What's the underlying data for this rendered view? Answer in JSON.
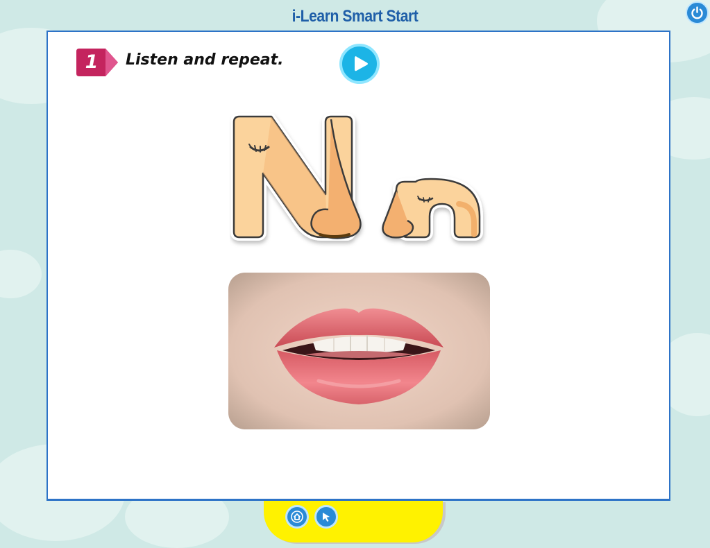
{
  "app": {
    "title": "i-Learn Smart Start"
  },
  "exercise": {
    "number": "1",
    "instruction": "Listen and repeat.",
    "letters_alt": "Nn"
  },
  "toolbar": {
    "power_icon": "power-icon",
    "play_icon": "play-icon",
    "home_icon": "home-icon",
    "pointer_icon": "cursor-icon"
  },
  "colors": {
    "background": "#cfe9e6",
    "title_blue": "#1f5fa8",
    "card_border": "#2d73c7",
    "badge_pink": "#c4245e",
    "play_blue": "#1cb4e6",
    "bottom_bar_yellow": "#fff200",
    "skin": "#fbd39c"
  }
}
